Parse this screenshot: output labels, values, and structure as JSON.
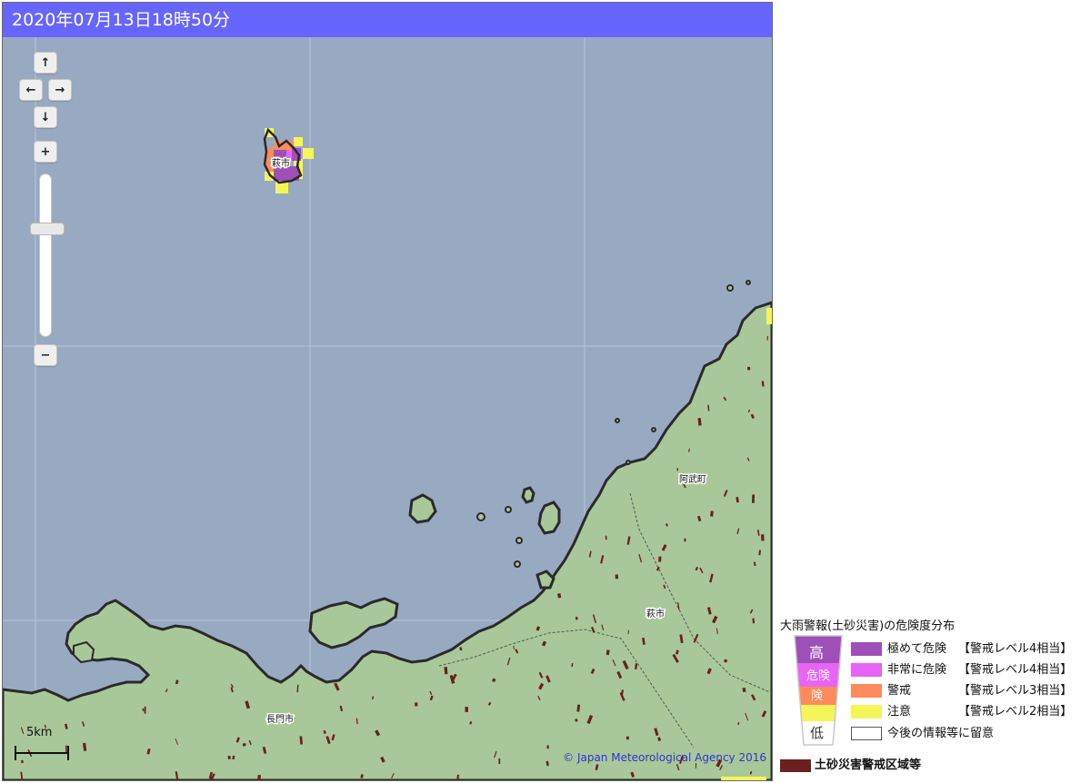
{
  "header": {
    "datetime": "2020年07月13日18時50分"
  },
  "map": {
    "controls": {
      "pan_up": "↑",
      "pan_left": "←",
      "pan_right": "→",
      "pan_down": "↓",
      "zoom_in": "+",
      "zoom_out": "−"
    },
    "scale_label": "5km",
    "copyright": "© Japan Meteorological Agency 2016",
    "place_labels": {
      "island_city": "萩市",
      "abu_town": "阿武町",
      "hagi_city": "萩市",
      "nagato_city": "長門市"
    },
    "colors": {
      "sea": "#98aac2",
      "land": "#a8c89a",
      "coast": "#2a2a2a",
      "warning_area": "#6b1f1f"
    }
  },
  "legend": {
    "title": "大雨警報(土砂災害)の危険度分布",
    "scale_high": "高",
    "scale_mid": "危険",
    "scale_mid2": "険",
    "scale_low": "低",
    "levels": [
      {
        "label": "極めて危険",
        "level": "【警戒レベル4相当】",
        "color": "#9e4fb8"
      },
      {
        "label": "非常に危険",
        "level": "【警戒レベル4相当】",
        "color": "#e864f5"
      },
      {
        "label": "警戒",
        "level": "【警戒レベル3相当】",
        "color": "#ff8a5c"
      },
      {
        "label": "注意",
        "level": "【警戒レベル2相当】",
        "color": "#f5f55a"
      },
      {
        "label": "今後の情報等に留意",
        "level": "",
        "color": "#ffffff"
      }
    ],
    "sediment_label": "土砂災害警戒区域等",
    "sediment_color": "#6b1f1f"
  }
}
